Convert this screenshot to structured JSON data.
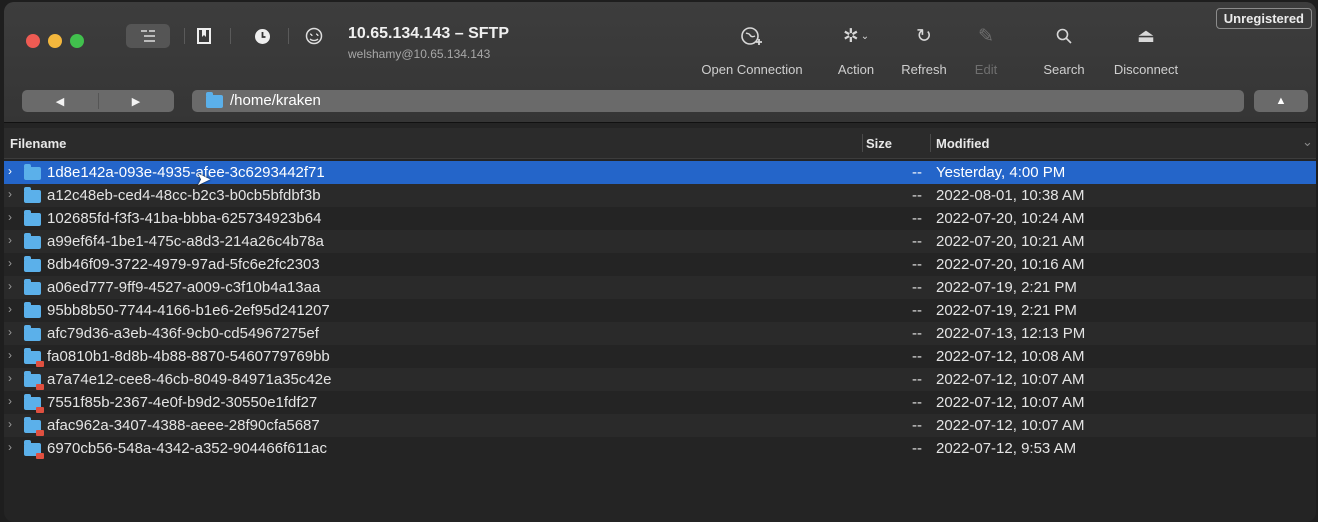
{
  "window": {
    "title": "10.65.134.143 – SFTP",
    "subtitle": "welshamy@10.65.134.143",
    "badge": "Unregistered"
  },
  "toolbar": {
    "actions": [
      {
        "label": "Open Connection",
        "icon": "globe-plus-icon"
      },
      {
        "label": "Action",
        "icon": "gear-dropdown-icon"
      },
      {
        "label": "Refresh",
        "icon": "refresh-icon"
      },
      {
        "label": "Edit",
        "icon": "pencil-icon"
      },
      {
        "label": "Search",
        "icon": "search-icon"
      },
      {
        "label": "Disconnect",
        "icon": "eject-icon"
      }
    ]
  },
  "path": {
    "current": "/home/kraken"
  },
  "columns": {
    "filename": "Filename",
    "size": "Size",
    "modified": "Modified"
  },
  "files": [
    {
      "name": "1d8e142a-093e-4935-afee-3c6293442f71",
      "size": "--",
      "modified": "Yesterday, 4:00 PM",
      "selected": true,
      "locked": false
    },
    {
      "name": "a12c48eb-ced4-48cc-b2c3-b0cb5bfdbf3b",
      "size": "--",
      "modified": "2022-08-01, 10:38 AM",
      "locked": false
    },
    {
      "name": "102685fd-f3f3-41ba-bbba-625734923b64",
      "size": "--",
      "modified": "2022-07-20, 10:24 AM",
      "locked": false
    },
    {
      "name": "a99ef6f4-1be1-475c-a8d3-214a26c4b78a",
      "size": "--",
      "modified": "2022-07-20, 10:21 AM",
      "locked": false
    },
    {
      "name": "8db46f09-3722-4979-97ad-5fc6e2fc2303",
      "size": "--",
      "modified": "2022-07-20, 10:16 AM",
      "locked": false
    },
    {
      "name": "a06ed777-9ff9-4527-a009-c3f10b4a13aa",
      "size": "--",
      "modified": "2022-07-19, 2:21 PM",
      "locked": false
    },
    {
      "name": "95bb8b50-7744-4166-b1e6-2ef95d241207",
      "size": "--",
      "modified": "2022-07-19, 2:21 PM",
      "locked": false
    },
    {
      "name": "afc79d36-a3eb-436f-9cb0-cd54967275ef",
      "size": "--",
      "modified": "2022-07-13, 12:13 PM",
      "locked": false
    },
    {
      "name": "fa0810b1-8d8b-4b88-8870-5460779769bb",
      "size": "--",
      "modified": "2022-07-12, 10:08 AM",
      "locked": true
    },
    {
      "name": "a7a74e12-cee8-46cb-8049-84971a35c42e",
      "size": "--",
      "modified": "2022-07-12, 10:07 AM",
      "locked": true
    },
    {
      "name": "7551f85b-2367-4e0f-b9d2-30550e1fdf27",
      "size": "--",
      "modified": "2022-07-12, 10:07 AM",
      "locked": true
    },
    {
      "name": "afac962a-3407-4388-aeee-28f90cfa5687",
      "size": "--",
      "modified": "2022-07-12, 10:07 AM",
      "locked": true
    },
    {
      "name": "6970cb56-548a-4342-a352-904466f611ac",
      "size": "--",
      "modified": "2022-07-12, 9:53 AM",
      "locked": true
    }
  ]
}
